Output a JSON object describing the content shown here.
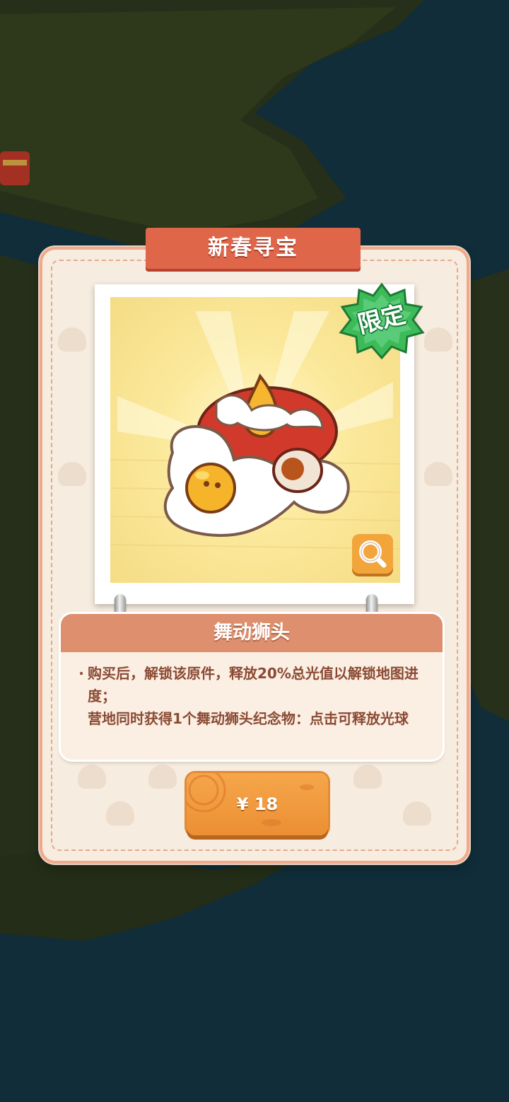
{
  "dialog": {
    "title": "新春寻宝",
    "limited_badge": "限定",
    "item_name": "舞动狮头",
    "description": {
      "bullet": "·",
      "line1": "购买后，解锁该原件，释放20%总光值以解锁地图进度；",
      "line2": "营地同时获得1个舞动狮头纪念物：点击可释放光球"
    },
    "price_label": "¥ 18"
  },
  "icons": {
    "magnify": "magnifier-icon",
    "item": "lion-head-icon",
    "badge": "star-burst-badge"
  },
  "colors": {
    "title_banner": "#e0664a",
    "panel": "#f6ecdf",
    "badge_green": "#3dbb59",
    "button_orange": "#ec8f33"
  }
}
